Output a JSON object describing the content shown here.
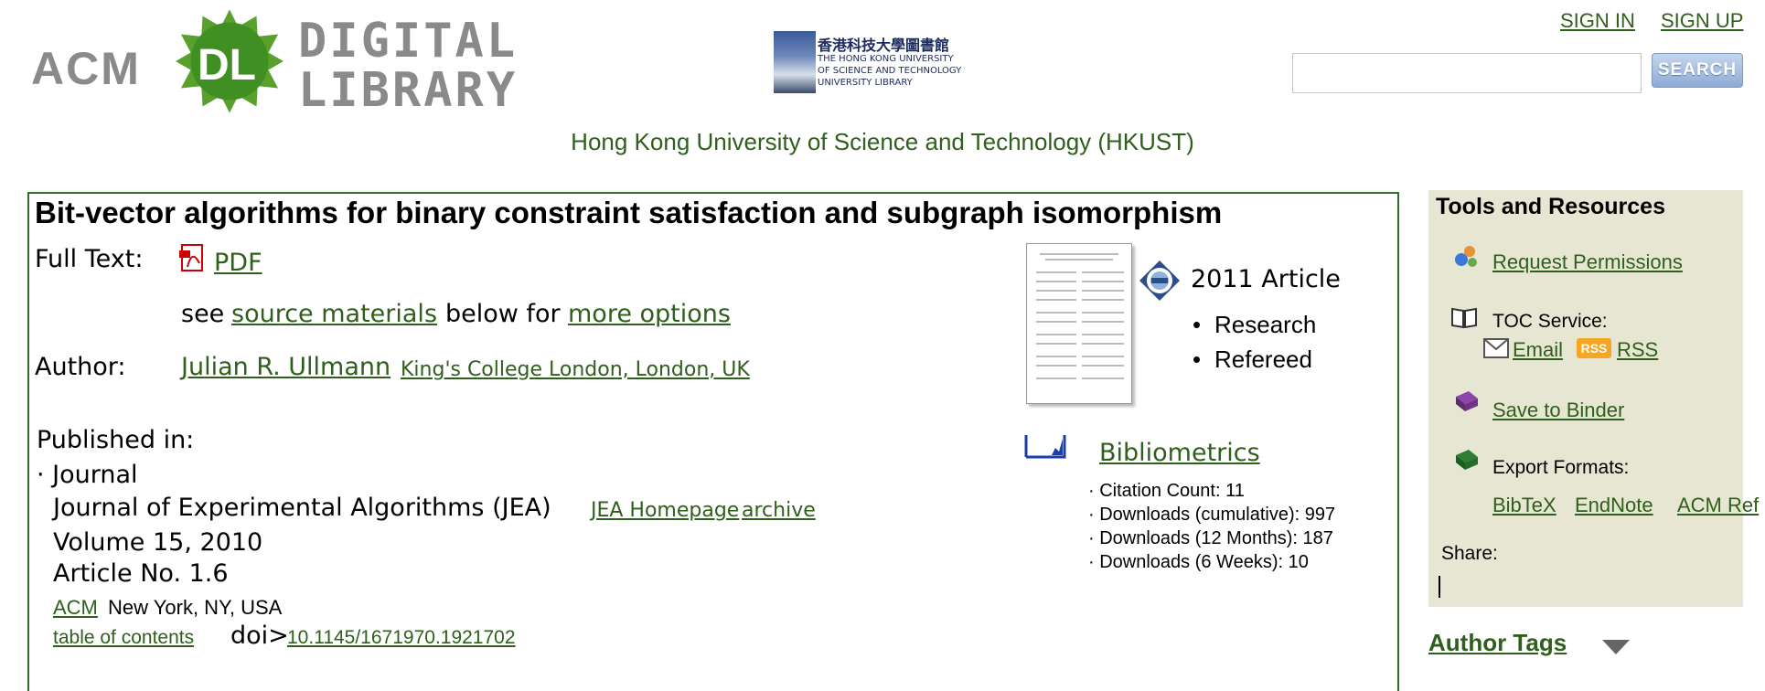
{
  "header": {
    "logo": {
      "acm": "ACM",
      "dl": "DL",
      "digital": "DIGITAL",
      "library": "LIBRARY"
    },
    "hkust_logo": {
      "chinese": "香港科技大學圖書館",
      "english_lines": [
        "THE HONG KONG UNIVERSITY",
        "OF SCIENCE AND TECHNOLOGY",
        "UNIVERSITY LIBRARY"
      ]
    },
    "sign_in": "SIGN IN",
    "sign_up": "SIGN UP",
    "search": {
      "value": "",
      "button": "SEARCH"
    },
    "institution": "Hong Kong University of Science and Technology (HKUST)"
  },
  "article": {
    "title": "Bit-vector algorithms for binary constraint satisfaction and subgraph isomorphism",
    "full_text_label": "Full Text:",
    "pdf": "PDF",
    "see": "see",
    "source_materials": "source materials",
    "below_for": "below for",
    "more_options": "more options",
    "author_label": "Author:",
    "author_name": "Julian R. Ullmann",
    "author_affiliation": "King's College London, London, UK",
    "published_in_label": "Published in:",
    "pub_type": "· Journal",
    "journal": "Journal of Experimental Algorithms (JEA)",
    "jea_homepage": "JEA Homepage",
    "archive": "archive",
    "volume": "Volume 15, 2010",
    "article_no": "Article No. 1.6",
    "publisher": "ACM",
    "publisher_location": "New York, NY, USA",
    "toc": "table of contents",
    "doi_label": "doi>",
    "doi": "10.1145/1671970.1921702",
    "year_type": "2011 Article",
    "tags": [
      "Research",
      "Refereed"
    ]
  },
  "bibliometrics": {
    "title": "Bibliometrics",
    "stats": [
      "· Citation Count: 11",
      "· Downloads (cumulative): 997",
      "· Downloads (12 Months): 187",
      "· Downloads (6 Weeks): 10"
    ]
  },
  "sidebar": {
    "title": "Tools and Resources",
    "request_permissions": "Request Permissions",
    "toc_service": "TOC Service:",
    "email": "Email",
    "rss_badge": "RSS",
    "rss": "RSS",
    "save_to_binder": "Save to Binder",
    "export_formats": "Export Formats:",
    "bibtex": "BibTeX",
    "endnote": "EndNote",
    "acm_ref": "ACM Ref",
    "share": "Share:",
    "author_tags": "Author Tags"
  },
  "colors": {
    "link_green": "#2f5f1c",
    "sidebar_bg": "#e7e6d2",
    "box_border": "#2f6f2a"
  }
}
